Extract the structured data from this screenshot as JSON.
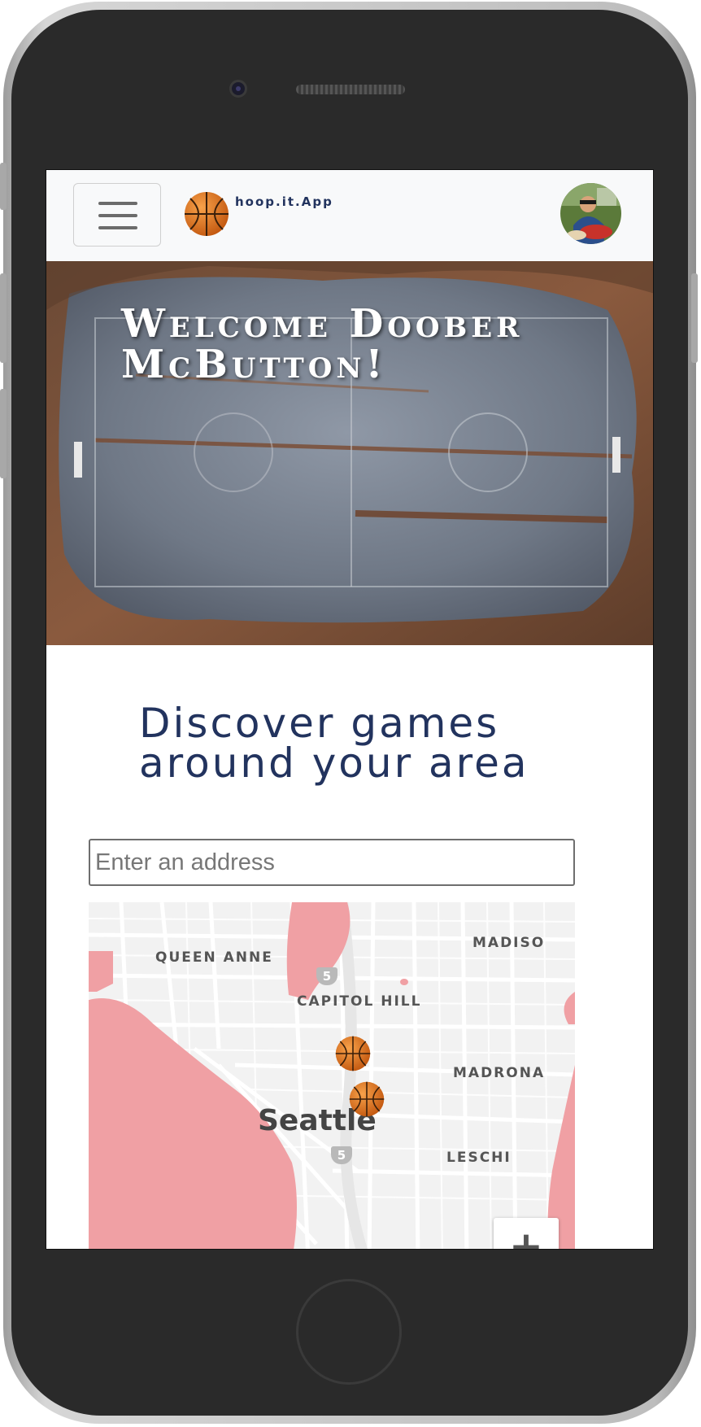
{
  "navbar": {
    "brand_text": "hoop.it.App",
    "menu_icon": "hamburger-icon",
    "brand_icon": "basketball-icon",
    "avatar": "user-avatar"
  },
  "hero": {
    "title": "Welcome Doober McButton!"
  },
  "discover": {
    "title": "Discover games around your area"
  },
  "search": {
    "placeholder": "Enter an address",
    "value": ""
  },
  "map": {
    "labels": {
      "queen_anne": "QUEEN ANNE",
      "capitol_hill": "CAPITOL HILL",
      "madison": "MADISO",
      "madrona": "MADRONA",
      "leschi": "LESCHI",
      "city": "Seattle"
    },
    "highway_shields": [
      "5",
      "5"
    ],
    "markers": [
      "basketball-icon",
      "basketball-icon"
    ],
    "zoom_in_label": "+"
  },
  "colors": {
    "brand_navy": "#22335e",
    "navbar_bg": "#f8f9fa",
    "water": "#f0a0a4",
    "map_land": "#f2f2f2",
    "basketball": "#e07a1f"
  }
}
